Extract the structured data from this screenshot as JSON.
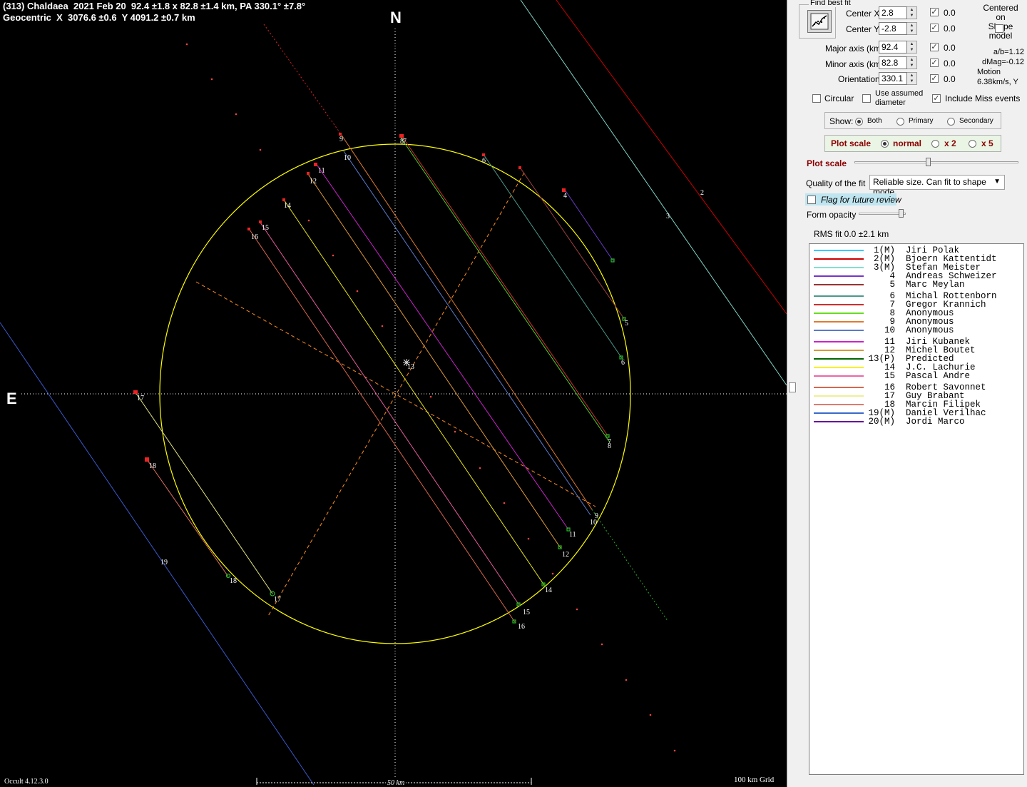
{
  "header": {
    "line1": "(313) Chaldaea  2021 Feb 20  92.4 ±1.8 x 82.8 ±1.4 km, PA 330.1° ±7.8°",
    "line2": "Geocentric  X  3076.6 ±0.6  Y 4091.2 ±0.7 km"
  },
  "compass": {
    "north": "N",
    "east": "E"
  },
  "footer": {
    "version": "Occult 4.12.3.0",
    "scale": "50 km",
    "grid": "100 km Grid"
  },
  "colors": {
    "ellipse": "#ffff00",
    "background": "#000000",
    "axes": "#ffffff",
    "diameter_lines": "#ff8c1a"
  },
  "chords": [
    {
      "id": "2",
      "color": "#cc0000"
    },
    {
      "id": "3",
      "color": "#7fd4c4"
    },
    {
      "id": "4",
      "color": "#6a3cc8"
    },
    {
      "id": "5",
      "color": "#a04040"
    },
    {
      "id": "6",
      "color": "#4a9a8a"
    },
    {
      "id": "7",
      "color": "#cc3030"
    },
    {
      "id": "8",
      "color": "#55cc22"
    },
    {
      "id": "9",
      "color": "#e07a30"
    },
    {
      "id": "10",
      "color": "#5a7acc"
    },
    {
      "id": "11",
      "color": "#cc22cc"
    },
    {
      "id": "12",
      "color": "#e09a3a"
    },
    {
      "id": "13",
      "color": "#666666"
    },
    {
      "id": "14",
      "color": "#e6e61a"
    },
    {
      "id": "15",
      "color": "#e65c9a"
    },
    {
      "id": "16",
      "color": "#d9664d"
    },
    {
      "id": "17",
      "color": "#e6e680"
    },
    {
      "id": "18",
      "color": "#e07060"
    },
    {
      "id": "19",
      "color": "#3a5acc"
    }
  ],
  "panel": {
    "find_best_fit": "Find best fit",
    "center_x_label": "Center X",
    "center_x": "2.8",
    "center_x_unc": "0.0",
    "center_y_label": "Center Y",
    "center_y": "-2.8",
    "center_y_unc": "0.0",
    "centered_on_shape": "Centered on\nShape model",
    "major_label": "Major axis (km)",
    "major": "92.4",
    "major_unc": "0.0",
    "minor_label": "Minor axis (km)",
    "minor": "82.8",
    "minor_unc": "0.0",
    "orient_label": "Orientation",
    "orient": "330.1",
    "orient_unc": "0.0",
    "ab_ratio": "a/b=1.12",
    "dmag": "dMag=-0.12",
    "motion_label": "Motion",
    "motion": "6.38km/s, Y",
    "circular": "Circular",
    "use_assumed": "Use assumed\ndiameter",
    "include_miss": "Include Miss events",
    "show_label": "Show:",
    "show_both": "Both",
    "show_primary": "Primary",
    "show_secondary": "Secondary",
    "plot_scale_title": "Plot scale",
    "scale_normal": "normal",
    "scale_x2": "x 2",
    "scale_x5": "x 5",
    "plot_scale_label": "Plot scale",
    "quality_label": "Quality of the fit",
    "quality_value": "Reliable size. Can fit to shape mode",
    "flag_review": "Flag for future review",
    "form_opacity": "Form opacity",
    "rms_fit": "RMS fit 0.0 ±2.1 km",
    "plot_scale_level": 0.45,
    "opacity_level": 0.95
  },
  "observers": [
    {
      "num": "1(M)",
      "name": "Jiri Polak",
      "color": "#33ccff"
    },
    {
      "num": "2(M)",
      "name": "Bjoern Kattentidt",
      "color": "#cc0000"
    },
    {
      "num": "3(M)",
      "name": "Stefan Meister",
      "color": "#7fe0d0"
    },
    {
      "num": "4",
      "name": "Andreas Schweizer",
      "color": "#7733cc"
    },
    {
      "num": "5",
      "name": "Marc Meylan",
      "color": "#993333"
    },
    {
      "num": "6",
      "name": "Michal Rottenborn",
      "color": "#4a9a8a"
    },
    {
      "num": "7",
      "name": "Gregor Krannich",
      "color": "#cc3030"
    },
    {
      "num": "8",
      "name": "Anonymous",
      "color": "#66dd22"
    },
    {
      "num": "9",
      "name": "Anonymous",
      "color": "#e07a30"
    },
    {
      "num": "10",
      "name": "Anonymous",
      "color": "#5a7acc"
    },
    {
      "num": "11",
      "name": "Jiri Kubanek",
      "color": "#cc22cc"
    },
    {
      "num": "12",
      "name": "Michel Boutet",
      "color": "#d49a3a"
    },
    {
      "num": "13(P)",
      "name": "Predicted",
      "color": "#006600"
    },
    {
      "num": "14",
      "name": "J.C. Lachurie",
      "color": "#ffee00"
    },
    {
      "num": "15",
      "name": "Pascal Andre",
      "color": "#ee66aa"
    },
    {
      "num": "16",
      "name": "Robert Savonnet",
      "color": "#d9664d"
    },
    {
      "num": "17",
      "name": "Guy Brabant",
      "color": "#eeee99"
    },
    {
      "num": "18",
      "name": "Marcin Filipek",
      "color": "#e07a6a"
    },
    {
      "num": "19(M)",
      "name": "Daniel Verilhac",
      "color": "#3a6acc"
    },
    {
      "num": "20(M)",
      "name": "Jordi Marco",
      "color": "#660099"
    }
  ]
}
